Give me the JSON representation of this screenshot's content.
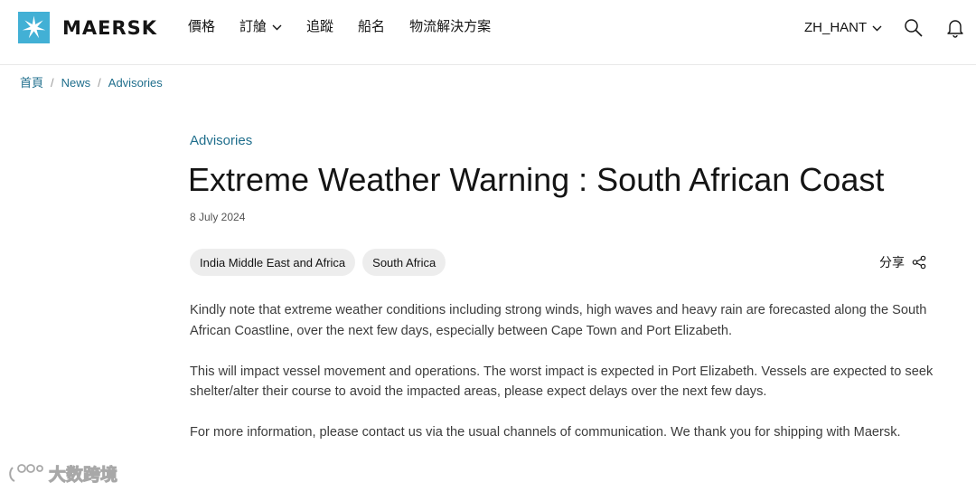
{
  "header": {
    "logo_text": "MAERSK",
    "nav": [
      {
        "label": "價格",
        "has_dropdown": false
      },
      {
        "label": "訂艙",
        "has_dropdown": true
      },
      {
        "label": "追蹤",
        "has_dropdown": false
      },
      {
        "label": "船名",
        "has_dropdown": false
      },
      {
        "label": "物流解決方案",
        "has_dropdown": false
      }
    ],
    "language": "ZH_HANT",
    "icons": [
      "search-icon",
      "bell-icon"
    ]
  },
  "breadcrumb": [
    "首頁",
    "News",
    "Advisories"
  ],
  "article": {
    "category": "Advisories",
    "title": "Extreme Weather Warning : South African Coast",
    "date": "8 July 2024",
    "tags": [
      "India Middle East and Africa",
      "South Africa"
    ],
    "share_label": "分享",
    "paragraphs": [
      "Kindly note that extreme weather conditions including strong winds, high waves and heavy rain are forecasted along the South African Coastline, over the next few days, especially between Cape Town and Port Elizabeth.",
      "This will impact vessel movement and operations. The worst impact is expected in Port Elizabeth. Vessels are expected to seek shelter/alter their course to avoid the impacted areas, please expect delays over the next few days.",
      "For more information, please contact us via the usual channels of communication. We thank you for shipping with Maersk."
    ]
  },
  "watermark": {
    "text": "大数跨境"
  },
  "colors": {
    "brand_blue": "#42b0d5",
    "link": "#1f6e8c",
    "text": "#141414",
    "tag_bg": "#ededed"
  }
}
